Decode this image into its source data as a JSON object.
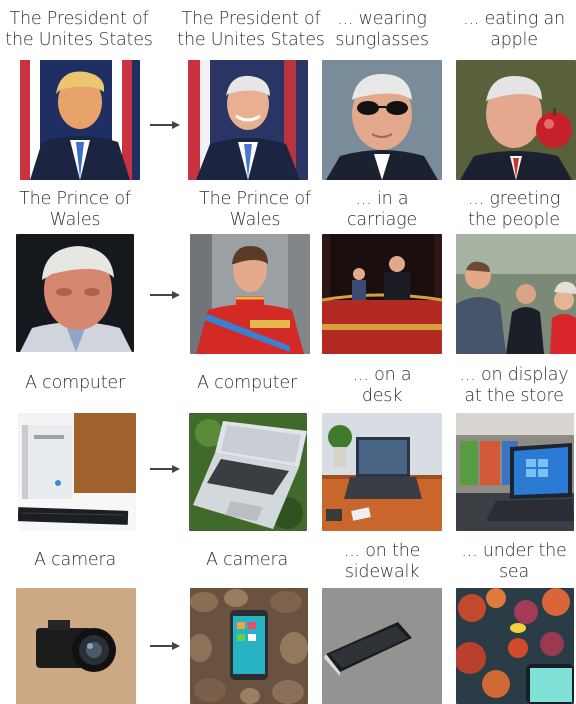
{
  "rows": [
    {
      "captions": [
        "The President of\nthe Unites States",
        "The President of\nthe Unites States",
        "... wearing\nsunglasses",
        "... eating an\napple"
      ],
      "images": [
        "president-portrait-image",
        "edited-president-portrait-image",
        "president-sunglasses-image",
        "president-apple-image"
      ]
    },
    {
      "captions": [
        "The Prince of\nWales",
        "The Prince of\nWales",
        "... in a\ncarriage",
        "... greeting\nthe people"
      ],
      "images": [
        "prince-portrait-image",
        "edited-prince-uniform-image",
        "prince-carriage-image",
        "prince-greeting-image"
      ]
    },
    {
      "captions": [
        "A computer",
        "A computer",
        "... on a\ndesk",
        "... on display\nat the store"
      ],
      "images": [
        "desktop-computer-image",
        "laptop-on-grass-image",
        "laptop-on-desk-image",
        "laptop-store-display-image"
      ]
    },
    {
      "captions": [
        "A camera",
        "A camera",
        "... on the\nsidewalk",
        "... under the\nsea"
      ],
      "images": [
        "camera-image",
        "phone-on-pebbles-image",
        "phone-on-sidewalk-image",
        "phone-under-sea-image"
      ]
    }
  ],
  "colors": {
    "arrow": "#444444",
    "text": "#333333"
  }
}
